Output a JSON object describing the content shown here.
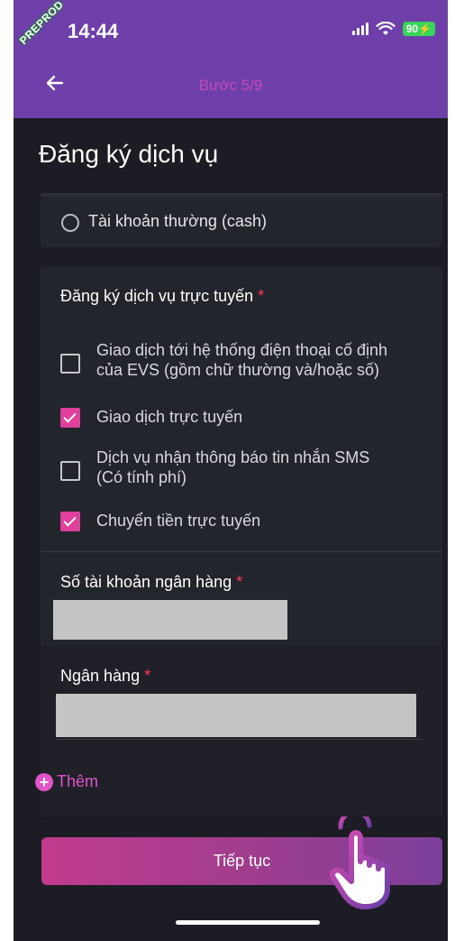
{
  "status_bar": {
    "time": "14:44",
    "badge": "PREPROD",
    "battery": "90"
  },
  "header": {
    "step": "Bước 5/9"
  },
  "page": {
    "title": "Đăng ký dịch vụ"
  },
  "account_type": {
    "option_label": "Tài khoản thường (cash)",
    "selected": false
  },
  "online_services": {
    "label": "Đăng ký dịch vụ trực tuyến",
    "required_mark": "*",
    "options": [
      {
        "label_line1": "Giao dịch tới hệ thống điện thoại cố định",
        "label_line2": "của EVS (gồm chữ thường và/hoặc số)",
        "checked": false
      },
      {
        "label_line1": "Giao dịch trực tuyến",
        "checked": true
      },
      {
        "label_line1": "Dịch vụ nhận thông báo tin nhắn SMS",
        "label_line2": "(Có tính phí)",
        "checked": false
      },
      {
        "label_line1": "Chuyển tiền trực tuyến",
        "checked": true
      }
    ]
  },
  "bank_account": {
    "label": "Số tài khoản ngân hàng",
    "required_mark": "*"
  },
  "bank": {
    "label": "Ngân hàng",
    "required_mark": "*"
  },
  "add_button": {
    "label": "Thêm"
  },
  "continue_button": {
    "label": "Tiếp tục"
  },
  "colors": {
    "header_purple": "#6f3fa9",
    "accent_pink": "#e0409c",
    "background": "#1c1d24"
  }
}
